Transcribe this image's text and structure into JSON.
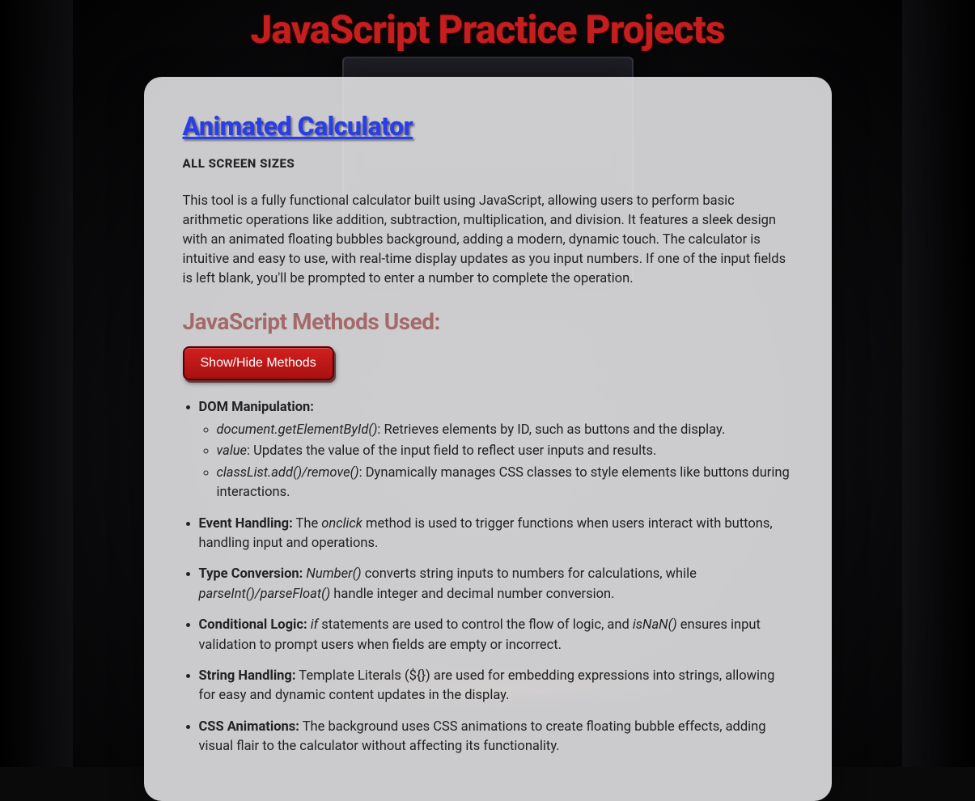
{
  "page_title": "JavaScript Practice Projects",
  "project": {
    "title_link": "Animated Calculator",
    "subhead": "ALL SCREEN SIZES",
    "description": "This tool is a fully functional calculator built using JavaScript, allowing users to perform basic arithmetic operations like addition, subtraction, multiplication, and division. It features a sleek design with an animated floating bubbles background, adding a modern, dynamic touch. The calculator is intuitive and easy to use, with real-time display updates as you input numbers. If one of the input fields is left blank, you'll be prompted to enter a number to complete the operation.",
    "methods_heading": "JavaScript Methods Used:",
    "toggle_label": "Show/Hide Methods",
    "methods": {
      "dom": {
        "label": "DOM Manipulation:",
        "items": {
          "getById_code": "document.getElementById()",
          "getById_text": ": Retrieves elements by ID, such as buttons and the display.",
          "value_code": "value",
          "value_text": ": Updates the value of the input field to reflect user inputs and results.",
          "classList_code": "classList.add()/remove()",
          "classList_text": ": Dynamically manages CSS classes to style elements like buttons during interactions."
        }
      },
      "event": {
        "label": "Event Handling:",
        "pre": " The ",
        "code": "onclick",
        "post": " method is used to trigger functions when users interact with buttons, handling input and operations."
      },
      "type": {
        "label": "Type Conversion:",
        "code1": "Number()",
        "mid1": " converts string inputs to numbers for calculations, while ",
        "code2": "parseInt()/parseFloat()",
        "mid2": " handle integer and decimal number conversion."
      },
      "cond": {
        "label": "Conditional Logic:",
        "code1": "if",
        "mid1": " statements are used to control the flow of logic, and ",
        "code2": "isNaN()",
        "mid2": " ensures input validation to prompt users when fields are empty or incorrect."
      },
      "string": {
        "label": "String Handling:",
        "text": " Template Literals (${}) are used for embedding expressions into strings, allowing for easy and dynamic content updates in the display."
      },
      "css": {
        "label": "CSS Animations:",
        "text": " The background uses CSS animations to create floating bubble effects, adding visual flair to the calculator without affecting its functionality."
      }
    }
  }
}
